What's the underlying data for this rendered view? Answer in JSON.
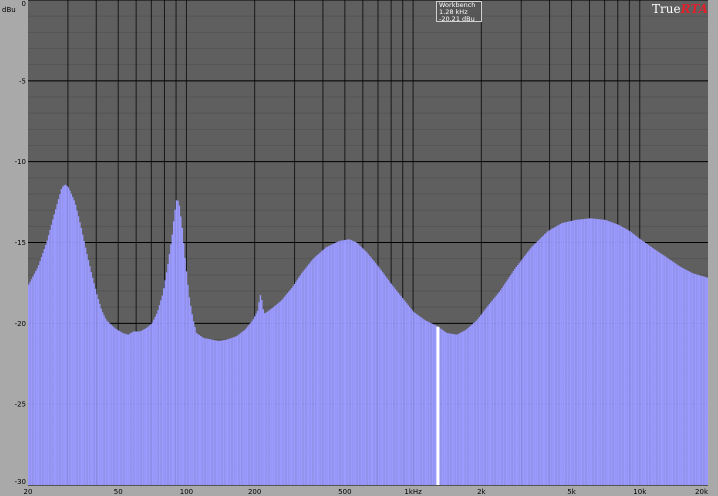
{
  "colors": {
    "plot_bg": "#5f5f5f",
    "fill": "#9a9aff",
    "grid_minor": "#555555",
    "grid_major": "#000000",
    "frame": "#a9a9a9",
    "cursor": "#ffffff"
  },
  "logo": {
    "part1": "True",
    "part2": "RTA"
  },
  "readout": {
    "line1": "Workbench",
    "line2": "1.28 kHz",
    "line3": "-20.21 dBu"
  },
  "chart_data": {
    "type": "area",
    "ylabel": "dBu",
    "xscale": "log",
    "xlim": [
      20,
      20000
    ],
    "ylim": [
      -30,
      0
    ],
    "grid": true,
    "x_ticks": [
      {
        "v": 20,
        "label": "20"
      },
      {
        "v": 50,
        "label": "50"
      },
      {
        "v": 100,
        "label": "100"
      },
      {
        "v": 200,
        "label": "200"
      },
      {
        "v": 500,
        "label": "500"
      },
      {
        "v": 1000,
        "label": "1kHz"
      },
      {
        "v": 2000,
        "label": "2k"
      },
      {
        "v": 5000,
        "label": "5k"
      },
      {
        "v": 10000,
        "label": "10k"
      },
      {
        "v": 20000,
        "label": "20k"
      }
    ],
    "y_ticks": [
      {
        "v": 0,
        "label": "0"
      },
      {
        "v": -5,
        "label": "-5"
      },
      {
        "v": -10,
        "label": "-10"
      },
      {
        "v": -15,
        "label": "-15"
      },
      {
        "v": -20,
        "label": "-20"
      },
      {
        "v": -25,
        "label": "-25"
      },
      {
        "v": -30,
        "label": "-30"
      }
    ],
    "cursor": {
      "x": 1280,
      "y": -20.21
    },
    "series": [
      {
        "points": [
          [
            20,
            -17.6
          ],
          [
            22,
            -16.5
          ],
          [
            24,
            -15.0
          ],
          [
            26,
            -13.2
          ],
          [
            28,
            -11.6
          ],
          [
            29,
            -11.4
          ],
          [
            30,
            -11.6
          ],
          [
            32,
            -12.5
          ],
          [
            34,
            -14.0
          ],
          [
            36,
            -15.6
          ],
          [
            38,
            -17.0
          ],
          [
            40,
            -18.2
          ],
          [
            42,
            -19.2
          ],
          [
            44,
            -19.8
          ],
          [
            48,
            -20.3
          ],
          [
            52,
            -20.6
          ],
          [
            55,
            -20.7
          ],
          [
            58,
            -20.5
          ],
          [
            62,
            -20.5
          ],
          [
            66,
            -20.3
          ],
          [
            70,
            -20.0
          ],
          [
            74,
            -19.3
          ],
          [
            78,
            -18.2
          ],
          [
            82,
            -16.5
          ],
          [
            86,
            -14.5
          ],
          [
            88,
            -13.2
          ],
          [
            90,
            -12.3
          ],
          [
            92,
            -12.5
          ],
          [
            95,
            -14.0
          ],
          [
            98,
            -16.0
          ],
          [
            102,
            -18.3
          ],
          [
            106,
            -19.7
          ],
          [
            110,
            -20.6
          ],
          [
            118,
            -20.9
          ],
          [
            128,
            -21.0
          ],
          [
            138,
            -21.1
          ],
          [
            150,
            -21.0
          ],
          [
            165,
            -20.8
          ],
          [
            180,
            -20.4
          ],
          [
            195,
            -19.8
          ],
          [
            205,
            -19.2
          ],
          [
            210,
            -18.2
          ],
          [
            214,
            -18.6
          ],
          [
            218,
            -19.4
          ],
          [
            225,
            -19.3
          ],
          [
            240,
            -19.0
          ],
          [
            260,
            -18.6
          ],
          [
            290,
            -17.8
          ],
          [
            320,
            -16.9
          ],
          [
            360,
            -16.0
          ],
          [
            410,
            -15.3
          ],
          [
            470,
            -14.9
          ],
          [
            520,
            -14.8
          ],
          [
            560,
            -15.0
          ],
          [
            620,
            -15.6
          ],
          [
            700,
            -16.5
          ],
          [
            800,
            -17.6
          ],
          [
            900,
            -18.5
          ],
          [
            1000,
            -19.3
          ],
          [
            1120,
            -19.8
          ],
          [
            1280,
            -20.2
          ],
          [
            1400,
            -20.6
          ],
          [
            1550,
            -20.7
          ],
          [
            1700,
            -20.4
          ],
          [
            1900,
            -19.8
          ],
          [
            2100,
            -19.0
          ],
          [
            2400,
            -18.0
          ],
          [
            2800,
            -16.6
          ],
          [
            3300,
            -15.3
          ],
          [
            3900,
            -14.3
          ],
          [
            4500,
            -13.8
          ],
          [
            5200,
            -13.6
          ],
          [
            6000,
            -13.5
          ],
          [
            7000,
            -13.6
          ],
          [
            8000,
            -13.9
          ],
          [
            9000,
            -14.3
          ],
          [
            10000,
            -14.8
          ],
          [
            11500,
            -15.4
          ],
          [
            13000,
            -15.9
          ],
          [
            15000,
            -16.5
          ],
          [
            17000,
            -16.9
          ],
          [
            19000,
            -17.1
          ],
          [
            20000,
            -17.2
          ]
        ]
      }
    ]
  }
}
